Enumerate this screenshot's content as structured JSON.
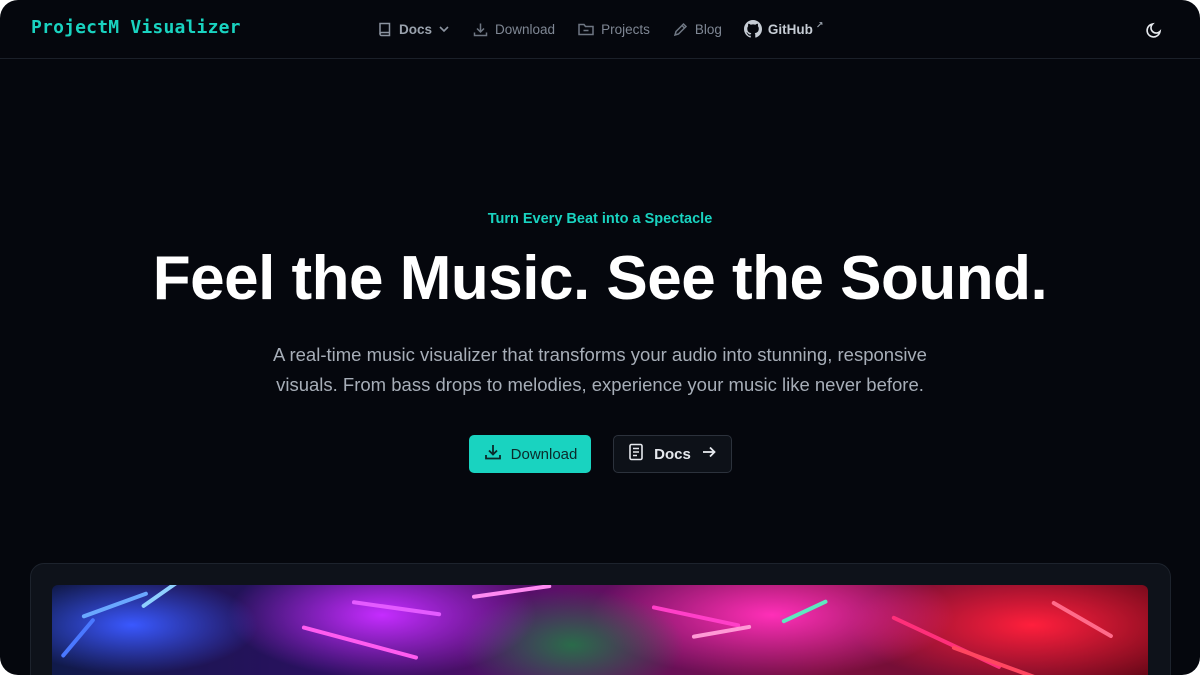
{
  "nav": {
    "brand": "ProjectM Visualizer",
    "items": [
      {
        "label": "Docs",
        "icon": "book-icon"
      },
      {
        "label": "Download",
        "icon": "download-icon"
      },
      {
        "label": "Projects",
        "icon": "folder-icon"
      },
      {
        "label": "Blog",
        "icon": "pencil-icon"
      },
      {
        "label": "GitHub",
        "icon": "github-icon",
        "external_mark": "↗"
      }
    ],
    "theme_toggle_icon": "moon-icon"
  },
  "hero": {
    "tagline": "Turn Every Beat into a Spectacle",
    "headline": "Feel the Music. See the Sound.",
    "subtitle": "A real-time music visualizer that transforms your audio into stunning, responsive visuals. From bass drops to melodies, experience your music like never before.",
    "primary_button": "Download",
    "secondary_button": "Docs"
  },
  "colors": {
    "accent": "#19d3c0",
    "background": "#05070d",
    "headline": "#ffffff",
    "muted_text": "#a7aeb8"
  }
}
